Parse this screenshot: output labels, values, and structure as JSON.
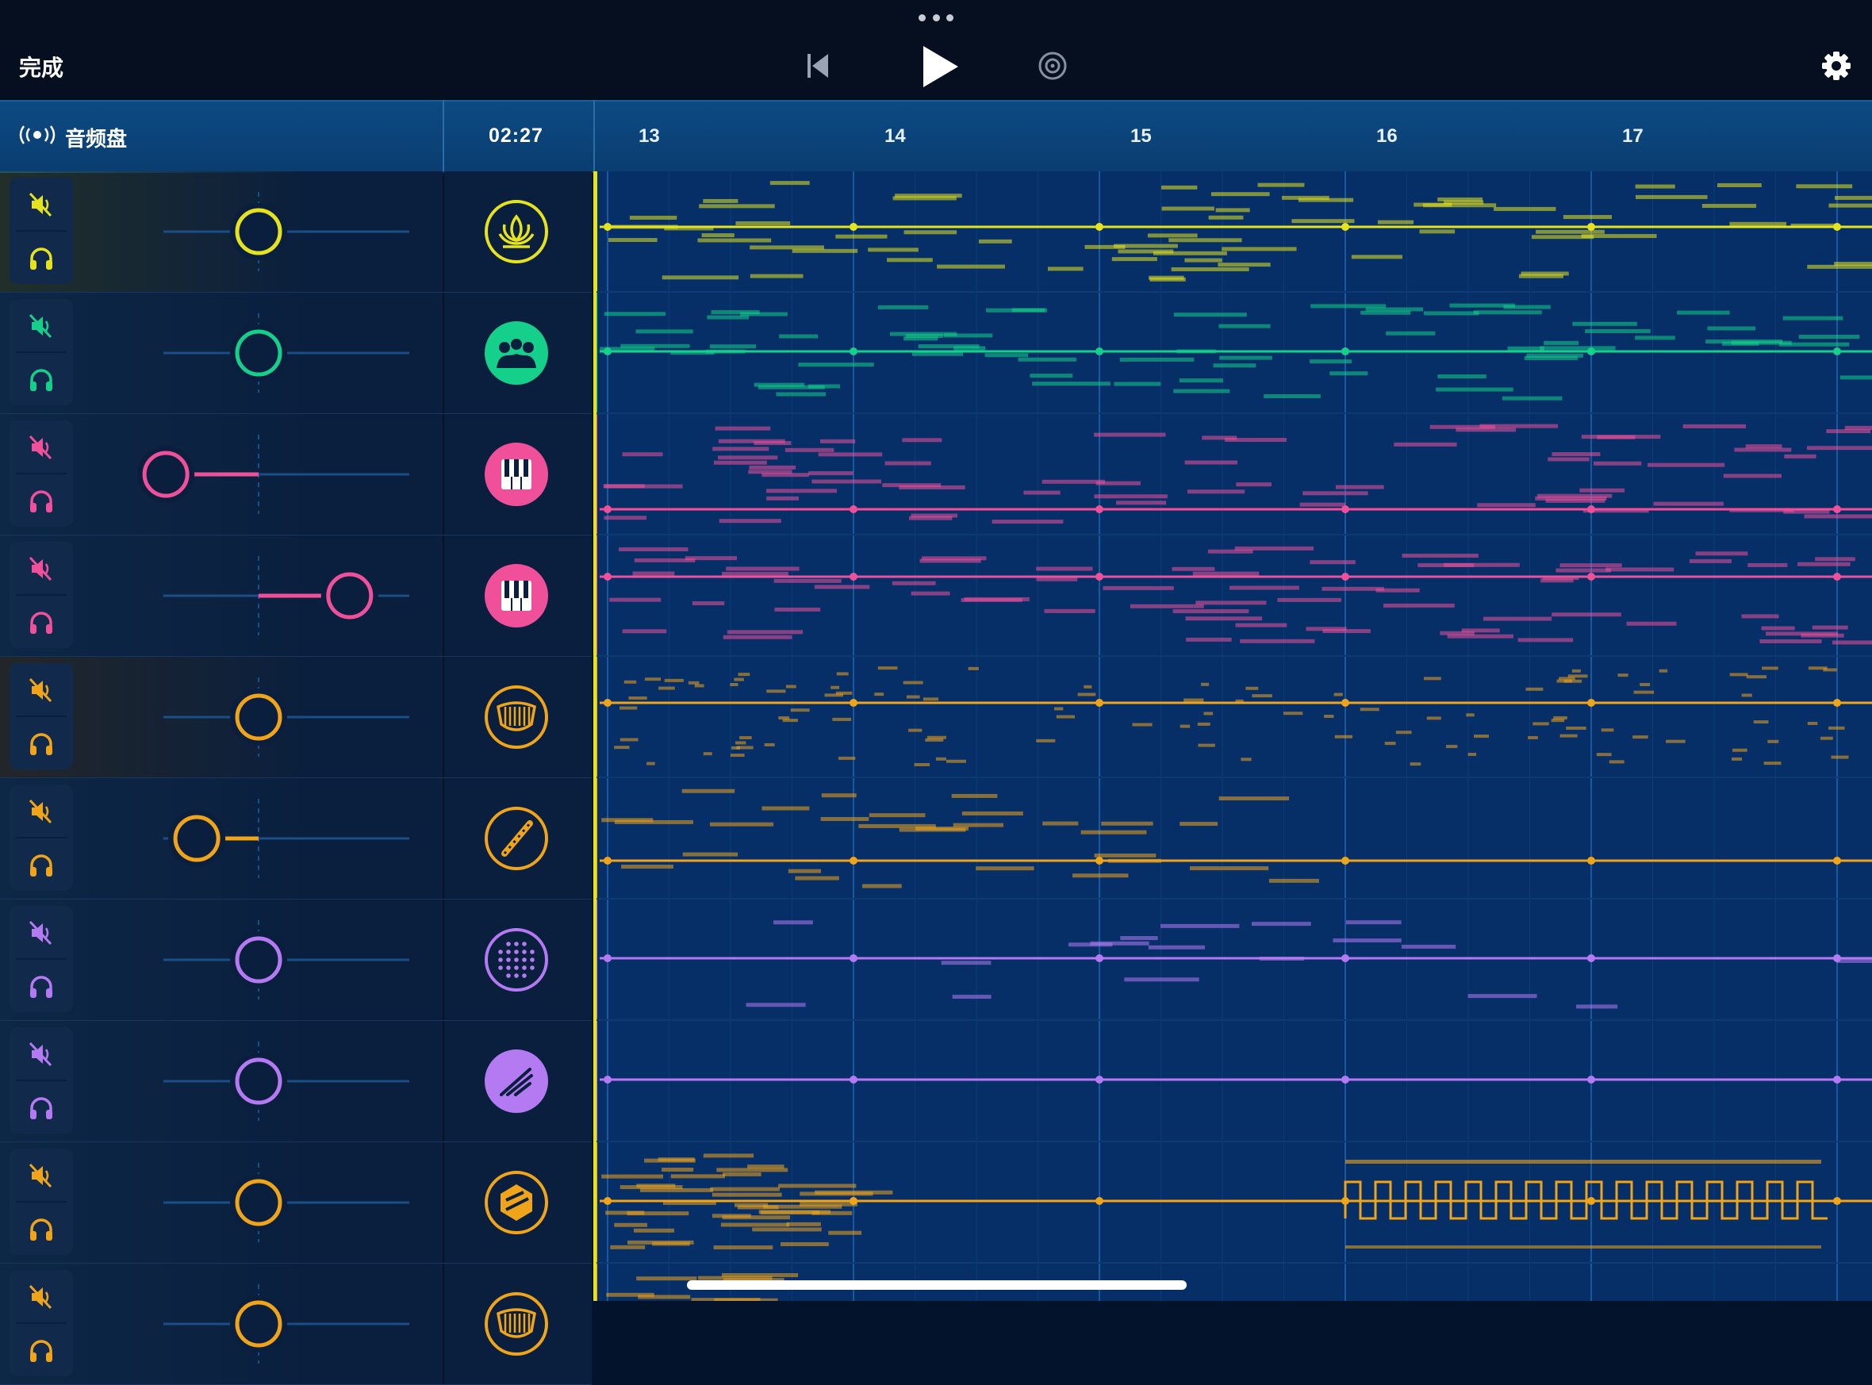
{
  "toolbar": {
    "done_label": "完成",
    "more_icon": "more-dots-icon",
    "rewind_icon": "skip-back-icon",
    "play_icon": "play-icon",
    "loop_icon": "record-disc-icon",
    "settings_icon": "gear-icon"
  },
  "header": {
    "audio_label": "音频盘",
    "audio_icon": "audio-broadcast-icon",
    "time": "02:27",
    "bars": [
      "13",
      "14",
      "15",
      "16",
      "17"
    ]
  },
  "colors": {
    "yellow": "#e6e31c",
    "green": "#15d08a",
    "pink": "#f0509a",
    "orange": "#f0a41a",
    "violet": "#b47af2"
  },
  "tracks": [
    {
      "color": "#e6e31c",
      "icon": "lotus-icon",
      "pan": 0,
      "muted": false
    },
    {
      "color": "#15d08a",
      "icon": "choir-icon",
      "pan": 0,
      "muted": false
    },
    {
      "color": "#f0509a",
      "icon": "piano-icon",
      "pan": -0.57,
      "muted": false
    },
    {
      "color": "#f0509a",
      "icon": "piano-icon",
      "pan": 0.56,
      "muted": false
    },
    {
      "color": "#f0a41a",
      "icon": "harp-icon",
      "pan": 0,
      "muted": false
    },
    {
      "color": "#f0a41a",
      "icon": "flute-icon",
      "pan": -0.38,
      "muted": false
    },
    {
      "color": "#b47af2",
      "icon": "dotted-sphere-icon",
      "pan": 0,
      "muted": false
    },
    {
      "color": "#b47af2",
      "icon": "brush-synth-icon",
      "pan": 0,
      "muted": false
    },
    {
      "color": "#f0a41a",
      "icon": "hexagon-drum-icon",
      "pan": 0,
      "muted": false
    },
    {
      "color": "#f0a41a",
      "icon": "harp-icon",
      "pan": 0,
      "muted": false
    }
  ]
}
